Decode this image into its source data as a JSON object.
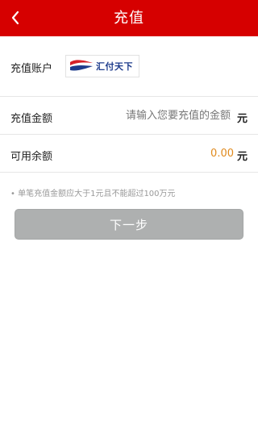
{
  "header": {
    "title": "充值",
    "back_icon": "chevron-left-icon"
  },
  "account": {
    "label": "充值账户",
    "logo_text": "汇付天下",
    "logo_colors": {
      "red": "#d62128",
      "blue": "#1e3c8c"
    }
  },
  "amount": {
    "label": "充值金额",
    "placeholder": "请输入您要充值的金额",
    "value": "",
    "unit": "元"
  },
  "balance": {
    "label": "可用余额",
    "value": "0.00",
    "unit": "元"
  },
  "hint": "• 单笔充值金额应大于1元且不能超过100万元",
  "next_button": {
    "label": "下一步"
  },
  "colors": {
    "header_bg": "#d60000",
    "balance_value": "#e08a1e",
    "button_bg": "#aeb0b0"
  }
}
